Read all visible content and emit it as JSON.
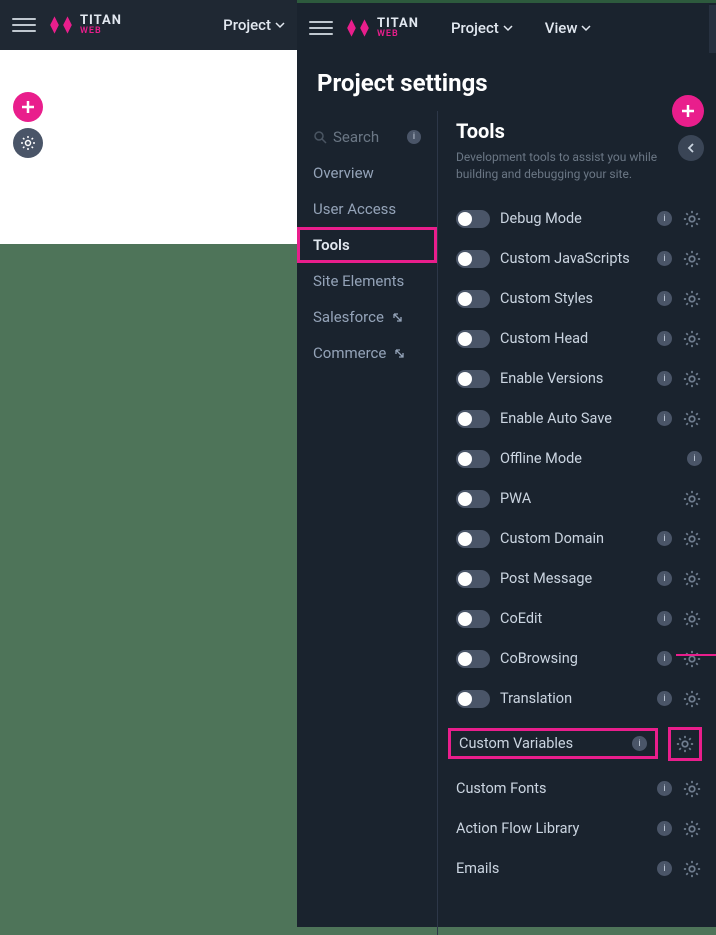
{
  "brand": {
    "title": "TITAN",
    "sub": "WEB"
  },
  "leftMenu": {
    "project": "Project"
  },
  "rightMenu": {
    "project": "Project",
    "view": "View"
  },
  "pageTitle": "Project settings",
  "nav": {
    "search": "Search",
    "items": [
      "Overview",
      "User Access",
      "Tools",
      "Site Elements",
      "Salesforce",
      "Commerce"
    ],
    "activeIndex": 2,
    "externalIndices": [
      4,
      5
    ]
  },
  "content": {
    "title": "Tools",
    "desc": "Development tools to assist you while building and debugging your site."
  },
  "tools": [
    {
      "label": "Debug Mode",
      "toggle": true,
      "gear": true,
      "info": true
    },
    {
      "label": "Custom JavaScripts",
      "toggle": true,
      "gear": true,
      "info": true
    },
    {
      "label": "Custom Styles",
      "toggle": true,
      "gear": true,
      "info": true
    },
    {
      "label": "Custom Head",
      "toggle": true,
      "gear": true,
      "info": true
    },
    {
      "label": "Enable Versions",
      "toggle": true,
      "gear": true,
      "info": true
    },
    {
      "label": "Enable Auto Save",
      "toggle": true,
      "gear": true,
      "info": true
    },
    {
      "label": "Offline Mode",
      "toggle": true,
      "gear": false,
      "info": true
    },
    {
      "label": "PWA",
      "toggle": true,
      "gear": true,
      "info": false
    },
    {
      "label": "Custom Domain",
      "toggle": true,
      "gear": true,
      "info": true
    },
    {
      "label": "Post Message",
      "toggle": true,
      "gear": true,
      "info": true
    },
    {
      "label": "CoEdit",
      "toggle": true,
      "gear": true,
      "info": true
    },
    {
      "label": "CoBrowsing",
      "toggle": true,
      "gear": true,
      "info": true
    },
    {
      "label": "Translation",
      "toggle": true,
      "gear": true,
      "info": true
    },
    {
      "label": "Custom Variables",
      "toggle": false,
      "gear": true,
      "info": true,
      "highlighted": true
    },
    {
      "label": "Custom Fonts",
      "toggle": false,
      "gear": true,
      "info": true
    },
    {
      "label": "Action Flow Library",
      "toggle": false,
      "gear": true,
      "info": true
    },
    {
      "label": "Emails",
      "toggle": false,
      "gear": true,
      "info": true
    }
  ]
}
